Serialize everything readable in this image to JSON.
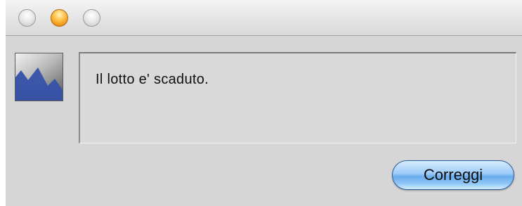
{
  "window": {
    "title": "",
    "controls": {
      "close": "close-button",
      "minimize": "minimize-button",
      "zoom": "zoom-button"
    }
  },
  "dialog": {
    "message": "Il lotto e' scaduto.",
    "icon": "app-icon",
    "button_label": "Correggi"
  },
  "colors": {
    "window_background": "#d6d6d6",
    "button_blue": "#6aacec",
    "minimize_orange": "#f2a21b"
  }
}
